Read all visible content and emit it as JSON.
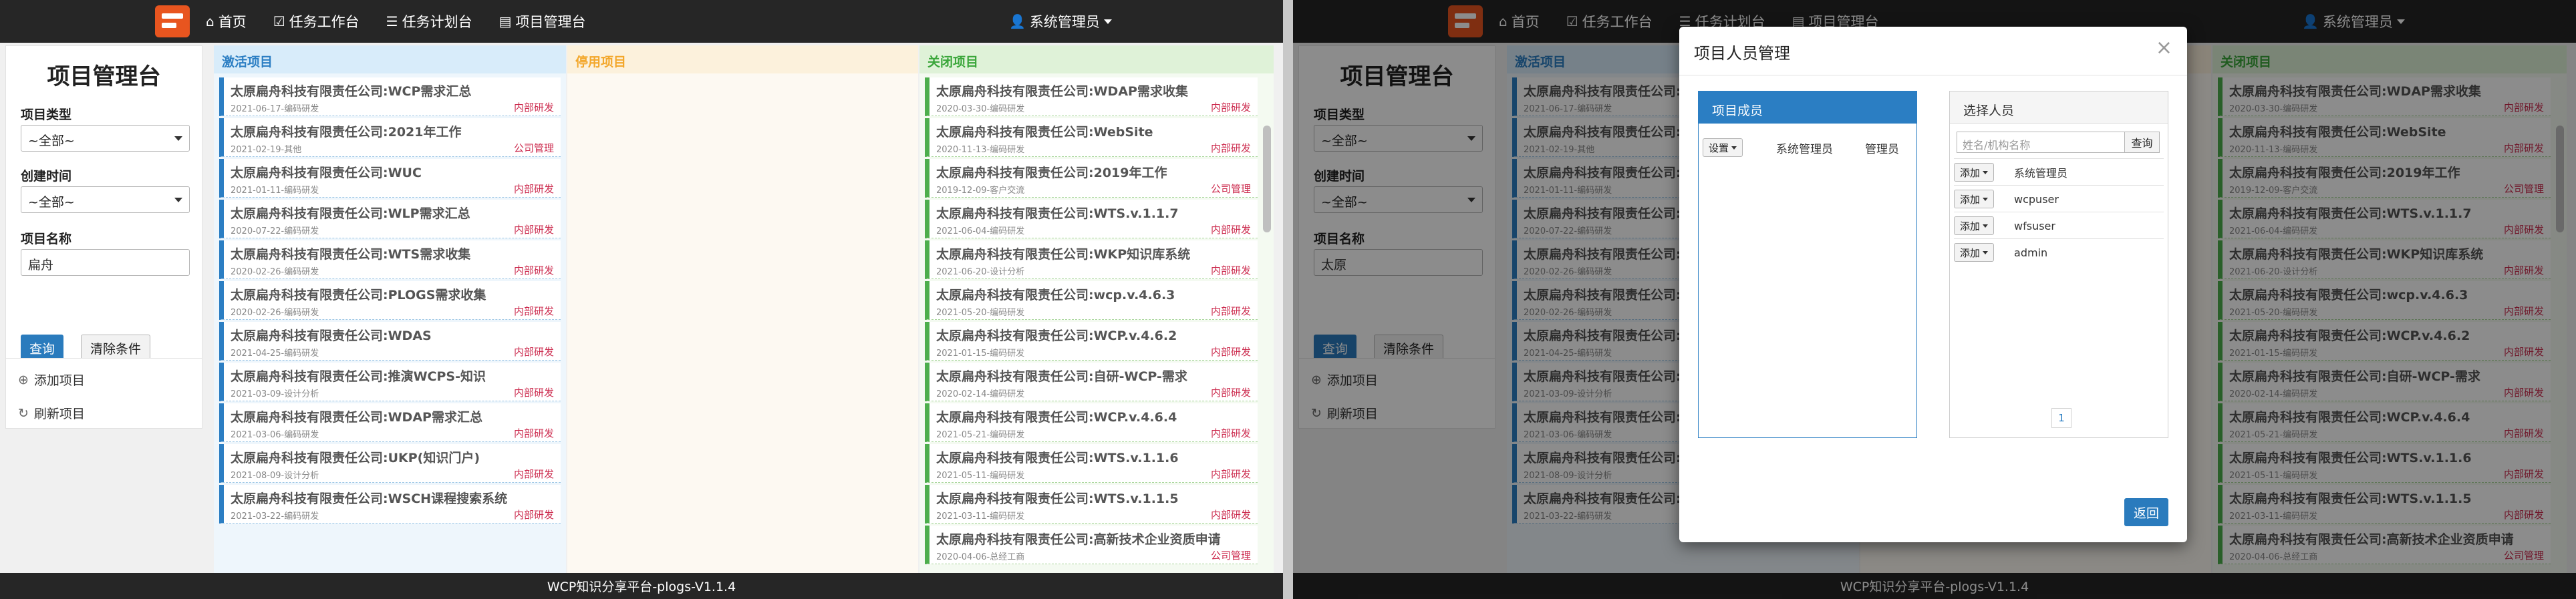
{
  "navbar": {
    "items": [
      {
        "label": "首页",
        "icon": "home-icon"
      },
      {
        "label": "任务工作台",
        "icon": "check-icon"
      },
      {
        "label": "任务计划台",
        "icon": "list-icon"
      },
      {
        "label": "项目管理台",
        "icon": "briefcase-icon"
      }
    ],
    "user": "系统管理员"
  },
  "sidebar": {
    "title": "项目管理台",
    "type_label": "项目类型",
    "type_value": "~全部~",
    "time_label": "创建时间",
    "time_value": "~全部~",
    "name_label": "项目名称",
    "query_button": "查询",
    "clear_button": "清除条件",
    "add_project": "添加项目",
    "refresh_project": "刷新项目"
  },
  "screens": [
    {
      "name_value": "扁舟"
    },
    {
      "name_value": "太原"
    }
  ],
  "columns": {
    "active": {
      "title": "激活项目",
      "cards": [
        {
          "title": "太原扁舟科技有限责任公司:WCP需求汇总",
          "meta": "2021-06-17-编码研发",
          "tag": "内部研发"
        },
        {
          "title": "太原扁舟科技有限责任公司:2021年工作",
          "meta": "2021-02-19-其他",
          "tag": "公司管理"
        },
        {
          "title": "太原扁舟科技有限责任公司:WUC",
          "meta": "2021-01-11-编码研发",
          "tag": "内部研发"
        },
        {
          "title": "太原扁舟科技有限责任公司:WLP需求汇总",
          "meta": "2020-07-22-编码研发",
          "tag": "内部研发"
        },
        {
          "title": "太原扁舟科技有限责任公司:WTS需求收集",
          "meta": "2020-02-26-编码研发",
          "tag": "内部研发"
        },
        {
          "title": "太原扁舟科技有限责任公司:PLOGS需求收集",
          "meta": "2020-02-26-编码研发",
          "tag": "内部研发"
        },
        {
          "title": "太原扁舟科技有限责任公司:WDAS",
          "meta": "2021-04-25-编码研发",
          "tag": "内部研发"
        },
        {
          "title": "太原扁舟科技有限责任公司:推演WCPS-知识",
          "meta": "2021-03-09-设计分析",
          "tag": "内部研发"
        },
        {
          "title": "太原扁舟科技有限责任公司:WDAP需求汇总",
          "meta": "2021-03-06-编码研发",
          "tag": "内部研发"
        },
        {
          "title": "太原扁舟科技有限责任公司:UKP(知识门户)",
          "meta": "2021-08-09-设计分析",
          "tag": "内部研发"
        },
        {
          "title": "太原扁舟科技有限责任公司:WSCH课程搜索系统",
          "meta": "2021-03-22-编码研发",
          "tag": "内部研发"
        }
      ]
    },
    "disabled": {
      "title": "停用项目"
    },
    "closed": {
      "title": "关闭项目",
      "cards": [
        {
          "title": "太原扁舟科技有限责任公司:WDAP需求收集",
          "meta": "2020-03-30-编码研发",
          "tag": "内部研发"
        },
        {
          "title": "太原扁舟科技有限责任公司:WebSite",
          "meta": "2020-11-13-编码研发",
          "tag": "内部研发"
        },
        {
          "title": "太原扁舟科技有限责任公司:2019年工作",
          "meta": "2019-12-09-客户交流",
          "tag": "公司管理"
        },
        {
          "title": "太原扁舟科技有限责任公司:WTS.v.1.1.7",
          "meta": "2021-06-04-编码研发",
          "tag": "内部研发"
        },
        {
          "title": "太原扁舟科技有限责任公司:WKP知识库系统",
          "meta": "2021-06-20-设计分析",
          "tag": "内部研发"
        },
        {
          "title": "太原扁舟科技有限责任公司:wcp.v.4.6.3",
          "meta": "2021-05-20-编码研发",
          "tag": "内部研发"
        },
        {
          "title": "太原扁舟科技有限责任公司:WCP.v.4.6.2",
          "meta": "2021-01-15-编码研发",
          "tag": "内部研发"
        },
        {
          "title": "太原扁舟科技有限责任公司:自研-WCP-需求",
          "meta": "2020-02-14-编码研发",
          "tag": "内部研发"
        },
        {
          "title": "太原扁舟科技有限责任公司:WCP.v.4.6.4",
          "meta": "2021-05-21-编码研发",
          "tag": "内部研发"
        },
        {
          "title": "太原扁舟科技有限责任公司:WTS.v.1.1.6",
          "meta": "2021-05-11-编码研发",
          "tag": "内部研发"
        },
        {
          "title": "太原扁舟科技有限责任公司:WTS.v.1.1.5",
          "meta": "2021-03-11-编码研发",
          "tag": "内部研发"
        },
        {
          "title": "太原扁舟科技有限责任公司:高新技术企业资质申请",
          "meta": "2020-04-06-总经工商",
          "tag": "公司管理"
        }
      ]
    }
  },
  "footer": "WCP知识分享平台-plogs-V1.1.4",
  "modal": {
    "title": "项目人员管理",
    "close": "×",
    "members_title": "项目成员",
    "settings_button": "设置",
    "col_admin": "系统管理员",
    "col_manager": "管理员",
    "select_title": "选择人员",
    "search_placeholder": "姓名/机构名称",
    "search_button": "查询",
    "add_button": "添加",
    "users": [
      "系统管理员",
      "wcpuser",
      "wfsuser",
      "admin"
    ],
    "page": "1",
    "return_button": "返回"
  }
}
